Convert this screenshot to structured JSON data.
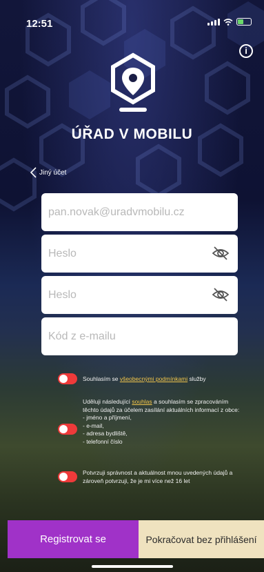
{
  "status_bar": {
    "time": "12:51"
  },
  "brand": {
    "name": "ÚŘAD V MOBILU"
  },
  "nav": {
    "back_label": "Jiný účet"
  },
  "form": {
    "email": {
      "value": "pan.novak@uradvmobilu.cz"
    },
    "password": {
      "placeholder": "Heslo"
    },
    "password_confirm": {
      "placeholder": "Heslo"
    },
    "email_code": {
      "placeholder": "Kód z e-mailu"
    }
  },
  "consents": [
    {
      "pre": "Souhlasím se ",
      "link": "všeobecnými podmínkami",
      "post": " služby"
    },
    {
      "pre": "Uděluji následující ",
      "link": "souhlas",
      "post": " a souhlasím se zpracováním těchto údajů za účelem zasílání aktuálních informací z obce:",
      "items": [
        "- jméno a příjmení,",
        "- e-mail,",
        "- adresa bydliště,",
        "- telefonní číslo"
      ]
    },
    {
      "text": "Potvrzuji správnost a aktuálnost mnou uvedených údajů a zároveň potvrzuji, že je mi více než 16 let"
    }
  ],
  "actions": {
    "register": "Registrovat se",
    "guest": "Pokračovat bez přihlášení"
  },
  "colors": {
    "accent": "#a032c8",
    "guest_bg": "#efe2bf",
    "toggle": "#ef3a3a",
    "link": "#f3c64a"
  }
}
